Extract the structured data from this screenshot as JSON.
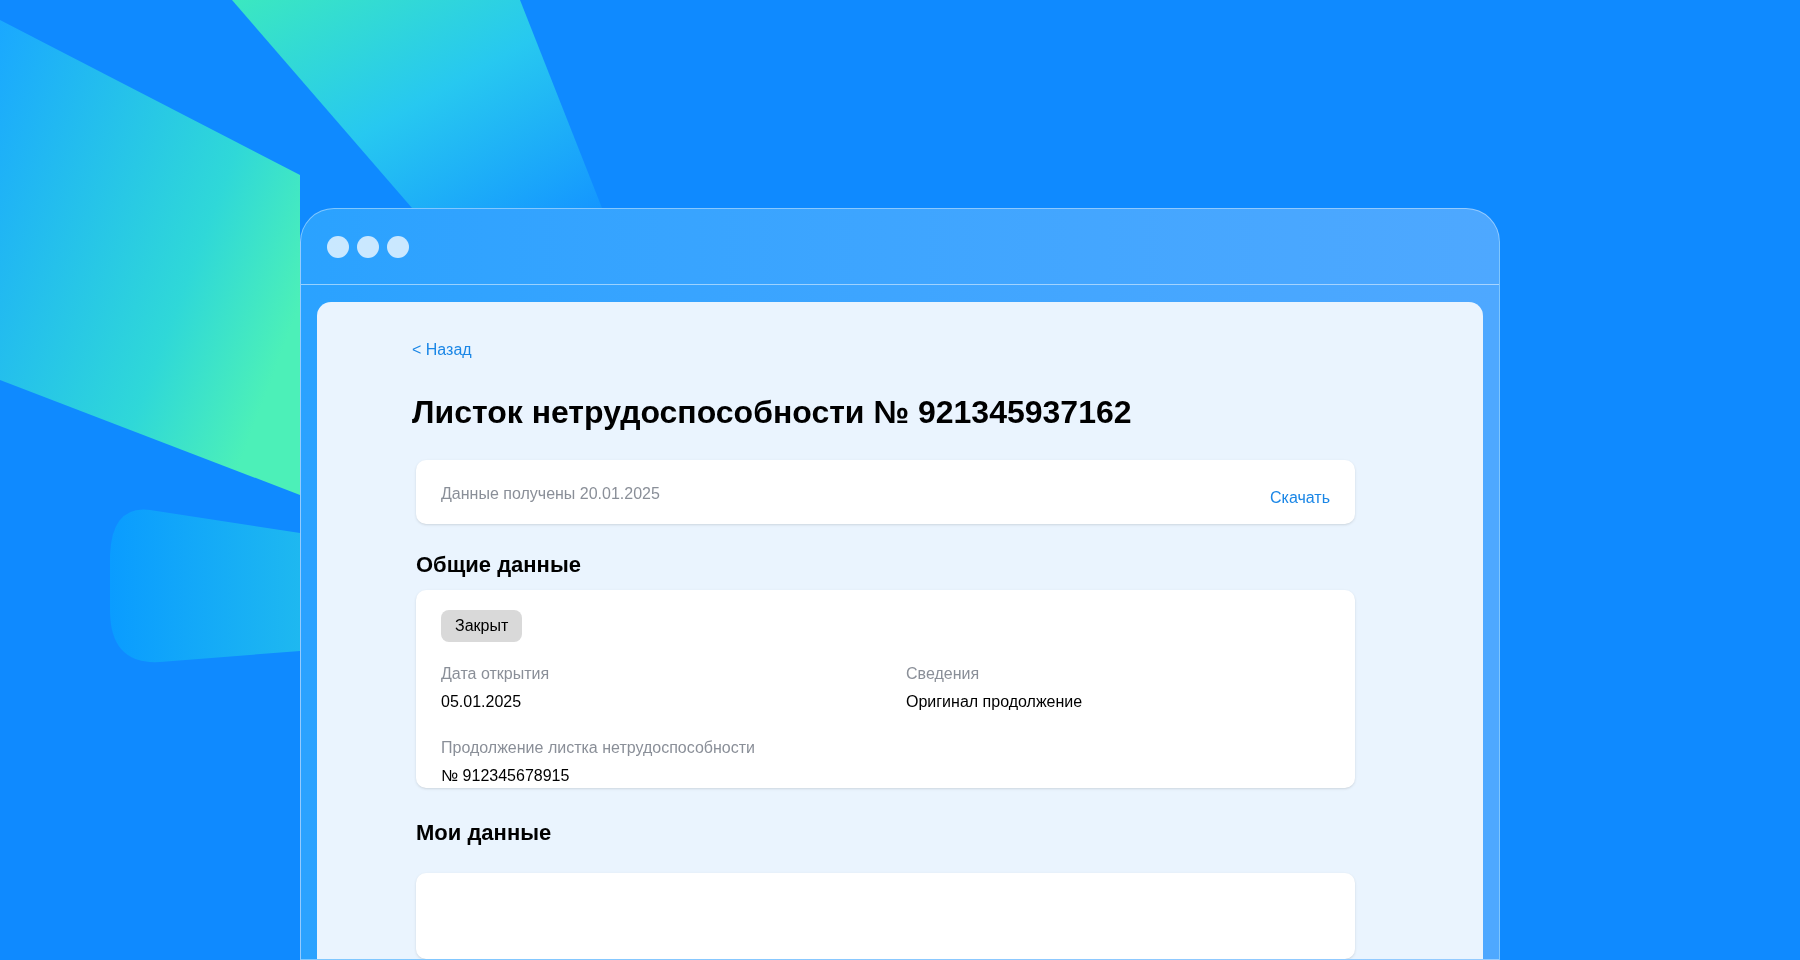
{
  "back_link": "< Назад",
  "title": "Листок нетрудоспособности № 921345937162",
  "received_card": {
    "text": "Данные получены 20.01.2025",
    "download": "Скачать"
  },
  "general": {
    "heading": "Общие данные",
    "status": "Закрыт",
    "fields": [
      {
        "label": "Дата открытия",
        "value": "05.01.2025"
      },
      {
        "label": "Сведения",
        "value": "Оригинал продолжение"
      },
      {
        "label": "Продолжение листка нетрудоспособности",
        "value": "№ 912345678915"
      }
    ]
  },
  "my_data": {
    "heading": "Мои данные"
  }
}
